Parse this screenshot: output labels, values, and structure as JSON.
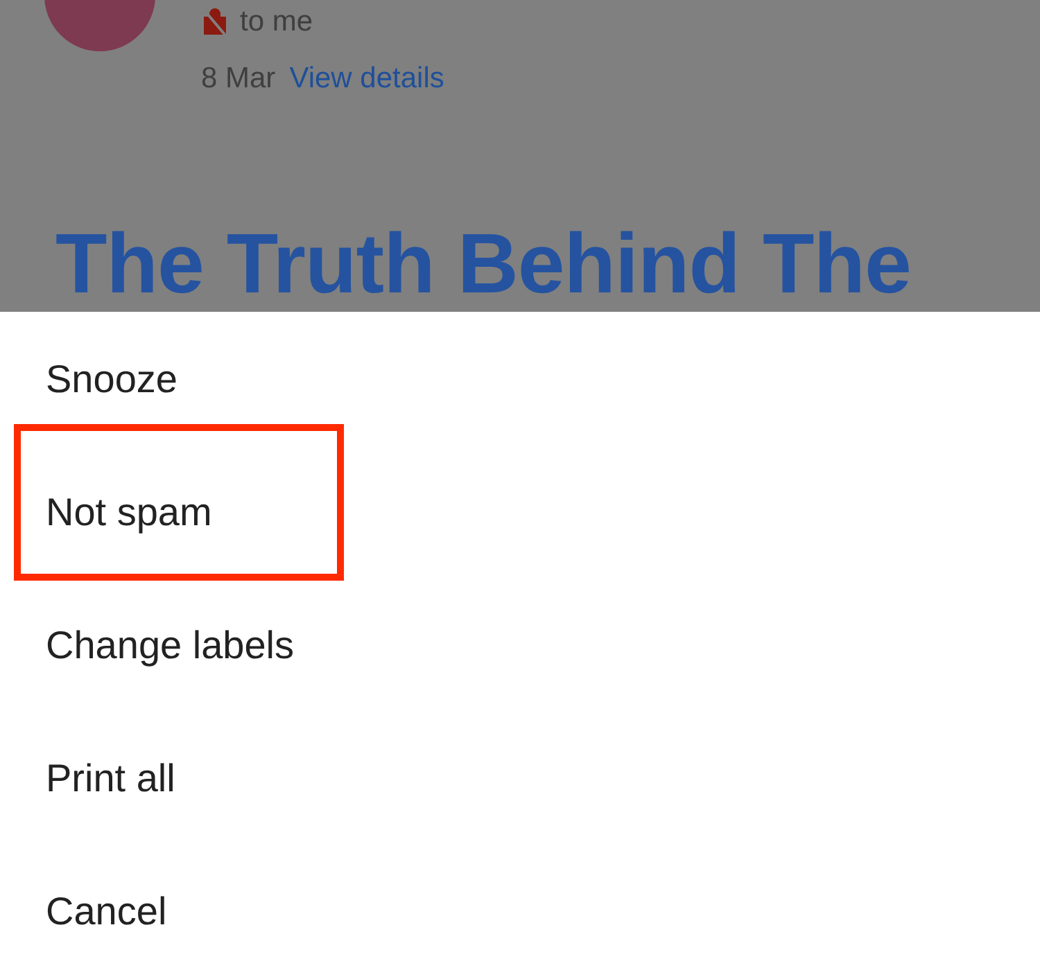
{
  "email": {
    "recipient": "to me",
    "date": "8 Mar",
    "details_link": "View details",
    "headline": "The Truth Behind The"
  },
  "menu": [
    {
      "label": "Snooze",
      "highlighted": false
    },
    {
      "label": "Not spam",
      "highlighted": true
    },
    {
      "label": "Change labels",
      "highlighted": false
    },
    {
      "label": "Print all",
      "highlighted": false
    },
    {
      "label": "Cancel",
      "highlighted": false
    }
  ]
}
